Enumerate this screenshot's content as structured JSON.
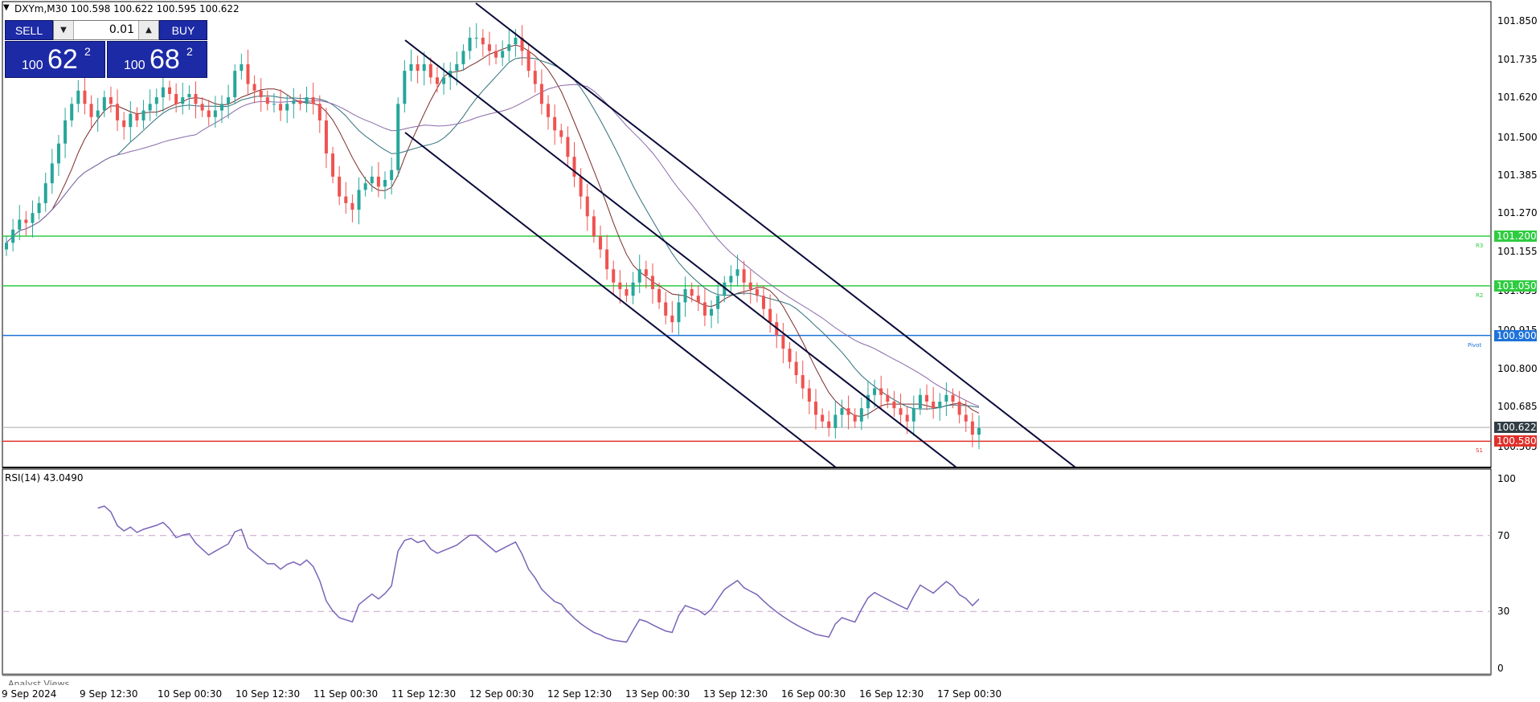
{
  "header": {
    "symbol_line": "DXYm,M30  100.598 100.622 100.595 100.622",
    "arrow_icon": "triangle-down-icon"
  },
  "trade_panel": {
    "sell_label": "SELL",
    "buy_label": "BUY",
    "lot_value": "0.01",
    "bid": {
      "prefix": "100",
      "big": "62",
      "sup": "2"
    },
    "ask": {
      "prefix": "100",
      "big": "68",
      "sup": "2"
    },
    "button_color": "#1c2aa6"
  },
  "price_axis": {
    "labels": [
      "101.850",
      "101.735",
      "101.620",
      "101.500",
      "101.385",
      "101.270",
      "101.155",
      "101.035",
      "100.915",
      "100.800",
      "100.685",
      "100.565"
    ],
    "ticks": [
      101.85,
      101.735,
      101.62,
      101.5,
      101.385,
      101.27,
      101.155,
      101.035,
      100.915,
      100.8,
      100.685,
      100.565
    ]
  },
  "levels": [
    {
      "name": "R3",
      "price": 101.2,
      "label": "101.200",
      "color": "#2ecc40"
    },
    {
      "name": "R2",
      "price": 101.05,
      "label": "101.050",
      "color": "#2ecc40"
    },
    {
      "name": "Pivot",
      "price": 100.9,
      "label": "100.900",
      "color": "#1e73d8"
    },
    {
      "name": "S1",
      "price": 100.58,
      "label": "100.580",
      "color": "#e0302a"
    }
  ],
  "current_price": {
    "price": 100.622,
    "label": "100.622",
    "color": "#303d44"
  },
  "rsi": {
    "title": "RSI(14) 43.0490",
    "axis_labels": [
      "100",
      "70",
      "30",
      "0"
    ],
    "levels": [
      70,
      30
    ],
    "line_color": "#7a64b8"
  },
  "analyst_text": "Analyst Views",
  "time_axis": [
    "9 Sep 2024",
    "9 Sep 12:30",
    "10 Sep 00:30",
    "10 Sep 12:30",
    "11 Sep 00:30",
    "11 Sep 12:30",
    "12 Sep 00:30",
    "12 Sep 12:30",
    "13 Sep 00:30",
    "13 Sep 12:30",
    "16 Sep 00:30",
    "16 Sep 12:30",
    "17 Sep 00:30"
  ],
  "chart_data": {
    "type": "candlestick",
    "symbol": "DXYm",
    "timeframe": "M30",
    "bull_color": "#26a69a",
    "bear_color": "#ef5350",
    "ylim": [
      100.53,
      101.88
    ],
    "close": [
      101.18,
      101.22,
      101.25,
      101.24,
      101.27,
      101.3,
      101.36,
      101.42,
      101.48,
      101.55,
      101.6,
      101.64,
      101.6,
      101.56,
      101.58,
      101.62,
      101.6,
      101.55,
      101.53,
      101.57,
      101.55,
      101.58,
      101.6,
      101.62,
      101.65,
      101.63,
      101.6,
      101.62,
      101.63,
      101.6,
      101.58,
      101.56,
      101.58,
      101.6,
      101.62,
      101.7,
      101.72,
      101.66,
      101.64,
      101.62,
      101.6,
      101.6,
      101.58,
      101.6,
      101.61,
      101.6,
      101.62,
      101.6,
      101.55,
      101.45,
      101.38,
      101.32,
      101.3,
      101.28,
      101.34,
      101.36,
      101.38,
      101.35,
      101.37,
      101.4,
      101.6,
      101.7,
      101.72,
      101.7,
      101.72,
      101.68,
      101.66,
      101.68,
      101.7,
      101.72,
      101.76,
      101.8,
      101.8,
      101.78,
      101.76,
      101.74,
      101.76,
      101.78,
      101.8,
      101.76,
      101.7,
      101.66,
      101.6,
      101.56,
      101.52,
      101.5,
      101.44,
      101.38,
      101.32,
      101.26,
      101.2,
      101.16,
      101.1,
      101.06,
      101.04,
      101.02,
      101.06,
      101.1,
      101.08,
      101.04,
      101.0,
      100.96,
      100.94,
      101.0,
      101.04,
      101.02,
      101.0,
      100.96,
      100.98,
      101.02,
      101.06,
      101.08,
      101.1,
      101.06,
      101.04,
      101.02,
      100.98,
      100.94,
      100.9,
      100.86,
      100.82,
      100.78,
      100.74,
      100.7,
      100.66,
      100.64,
      100.62,
      100.66,
      100.68,
      100.66,
      100.64,
      100.68,
      100.72,
      100.74,
      100.72,
      100.7,
      100.68,
      100.66,
      100.64,
      100.68,
      100.72,
      100.7,
      100.68,
      100.7,
      100.72,
      100.7,
      100.66,
      100.64,
      100.6,
      100.62
    ]
  }
}
